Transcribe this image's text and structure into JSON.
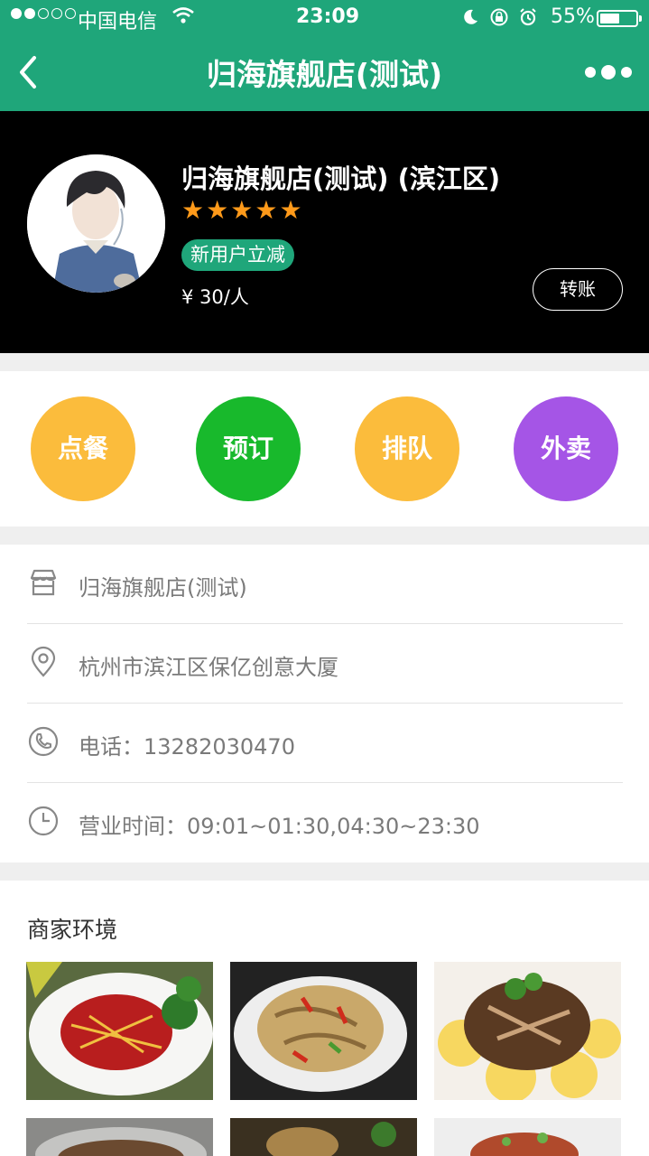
{
  "status_bar": {
    "carrier": "中国电信",
    "time": "23:09",
    "battery_percent": "55%",
    "battery_level": 0.55
  },
  "nav": {
    "title": "归海旗舰店(测试)"
  },
  "shop": {
    "name": "归海旗舰店(测试) (滨江区)",
    "rating": 5,
    "promo": "新用户立减",
    "price": "¥ 30/人",
    "transfer_label": "转账"
  },
  "actions": [
    {
      "label": "点餐",
      "color": "#fbbc3c"
    },
    {
      "label": "预订",
      "color": "#18b92c"
    },
    {
      "label": "排队",
      "color": "#fbbc3c"
    },
    {
      "label": "外卖",
      "color": "#a555e6"
    }
  ],
  "info": {
    "store": "归海旗舰店(测试)",
    "address": "杭州市滨江区保亿创意大厦",
    "phone": "电话：13282030470",
    "hours": "营业时间：09:01~01:30,04:30~23:30"
  },
  "gallery": {
    "title": "商家环境"
  },
  "colors": {
    "brand": "#1fa67a",
    "star": "#ff9a1a"
  }
}
